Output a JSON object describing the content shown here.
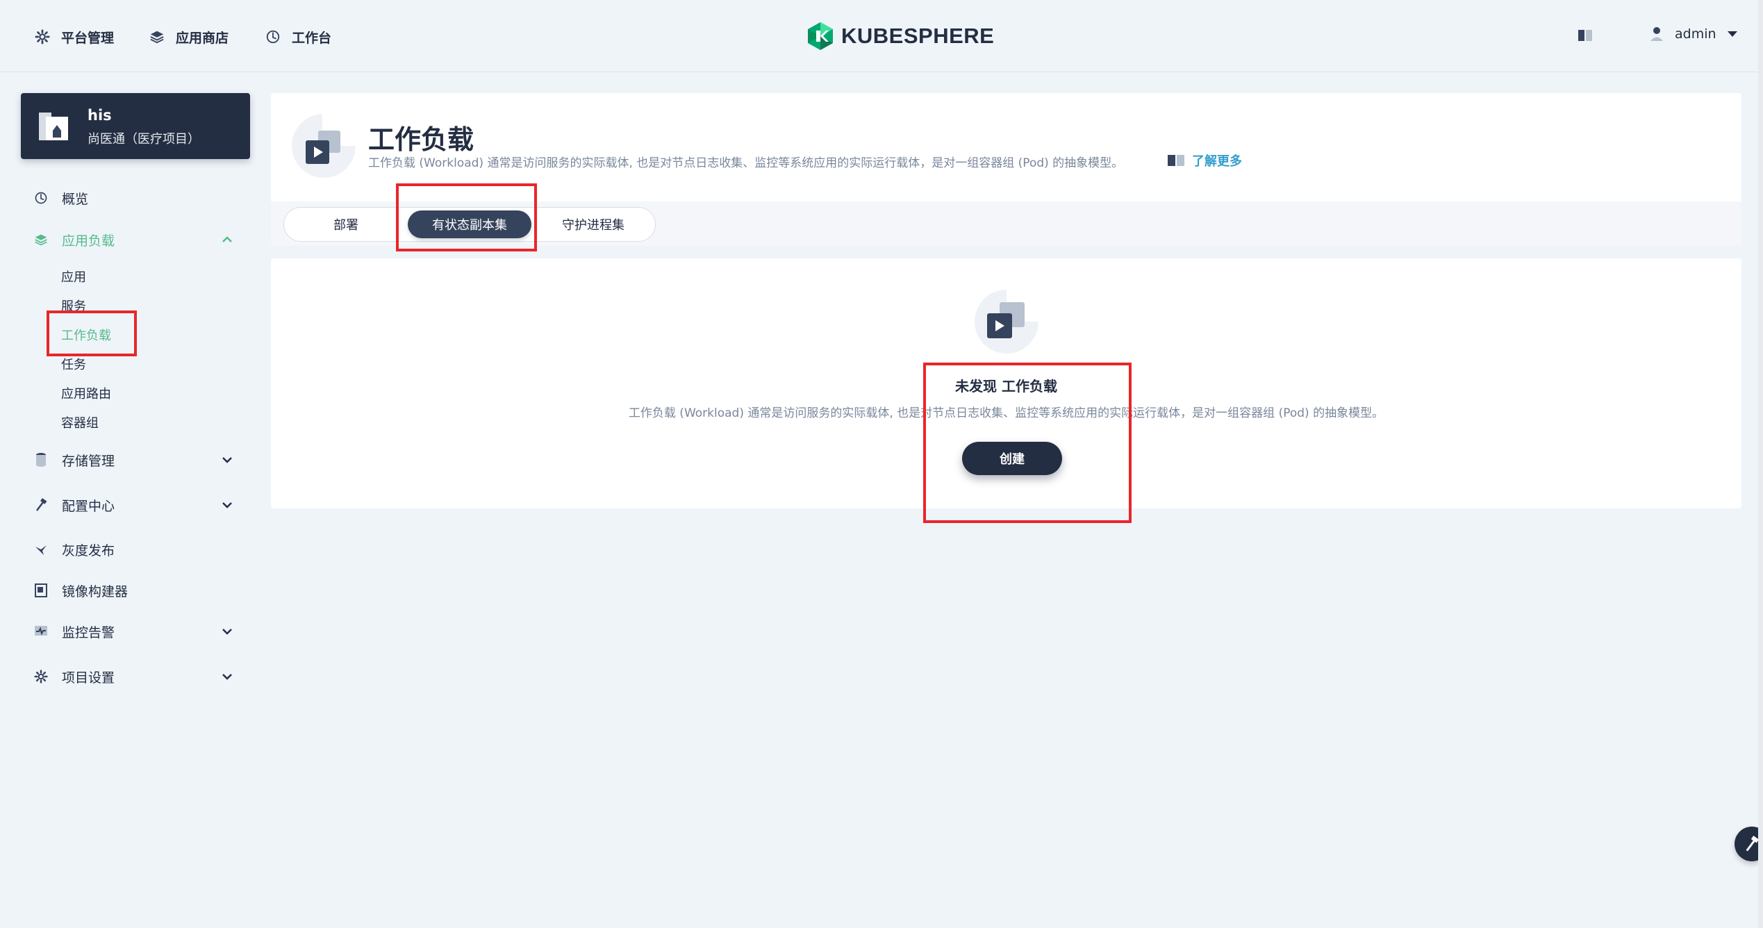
{
  "topnav": {
    "platform": "平台管理",
    "appstore": "应用商店",
    "workbench": "工作台",
    "logo": "KUBESPHERE",
    "user": "admin"
  },
  "project": {
    "name": "his",
    "desc": "尚医通（医疗项目）"
  },
  "sidebar": {
    "overview": "概览",
    "app_workloads": "应用负载",
    "sub": [
      "应用",
      "服务",
      "工作负载",
      "任务",
      "应用路由",
      "容器组"
    ],
    "storage": "存储管理",
    "config": "配置中心",
    "grayscale": "灰度发布",
    "image_builder": "镜像构建器",
    "monitoring": "监控告警",
    "project_settings": "项目设置"
  },
  "header": {
    "title": "工作负载",
    "desc": "工作负载 (Workload) 通常是访问服务的实际载体, 也是对节点日志收集、监控等系统应用的实际运行载体，是对一组容器组 (Pod) 的抽象模型。",
    "learn_more": "了解更多"
  },
  "tabs": [
    "部署",
    "有状态副本集",
    "守护进程集"
  ],
  "active_tab": "有状态副本集",
  "empty": {
    "title": "未发现 工作负载",
    "desc": "工作负载 (Workload) 通常是访问服务的实际载体, 也是对节点日志收集、监控等系统应用的实际运行载体，是对一组容器组 (Pod) 的抽象模型。",
    "create": "创建"
  },
  "colors": {
    "primary": "#242e42",
    "accent_green": "#55bc8a",
    "link_blue": "#329dce",
    "annotation_red": "#e8262a"
  }
}
